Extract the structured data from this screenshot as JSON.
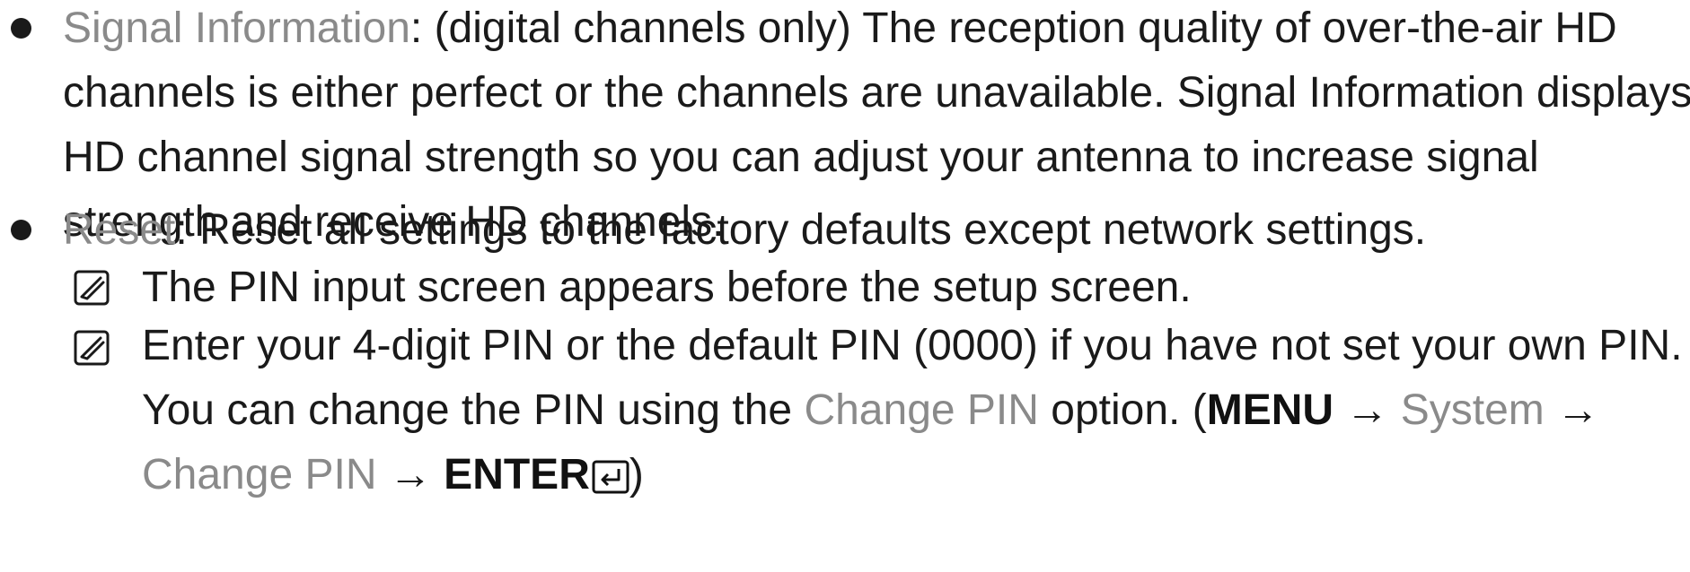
{
  "colors": {
    "text": "#1a1a1a",
    "menu_term": "#8a8a8a",
    "bold": "#111111"
  },
  "bullets": [
    {
      "term": "Signal Information",
      "after_term": ": (digital channels only) The reception quality of over-the-air HD channels is either perfect or the channels are unavailable. Signal Information displays HD channel signal strength so you can adjust your antenna to increase signal strength and receive HD channels."
    },
    {
      "term": "Reset",
      "after_term": ": Reset all settings to the factory defaults except network settings."
    }
  ],
  "notes": [
    {
      "icon": "note-icon",
      "text": "The PIN input screen appears before the setup screen."
    },
    {
      "icon": "note-icon",
      "text_before": "Enter your 4-digit PIN or the default PIN (0000) if you have not set your own PIN. You can change the PIN using the ",
      "term1": "Change PIN",
      "text_mid": " option. (",
      "menu": "MENU",
      "arrow1": " → ",
      "system": "System",
      "arrow2": " → ",
      "term2": "Change PIN",
      "arrow3": " → ",
      "enter": "ENTER",
      "enter_icon": "enter-key-icon",
      "close": ")"
    }
  ]
}
